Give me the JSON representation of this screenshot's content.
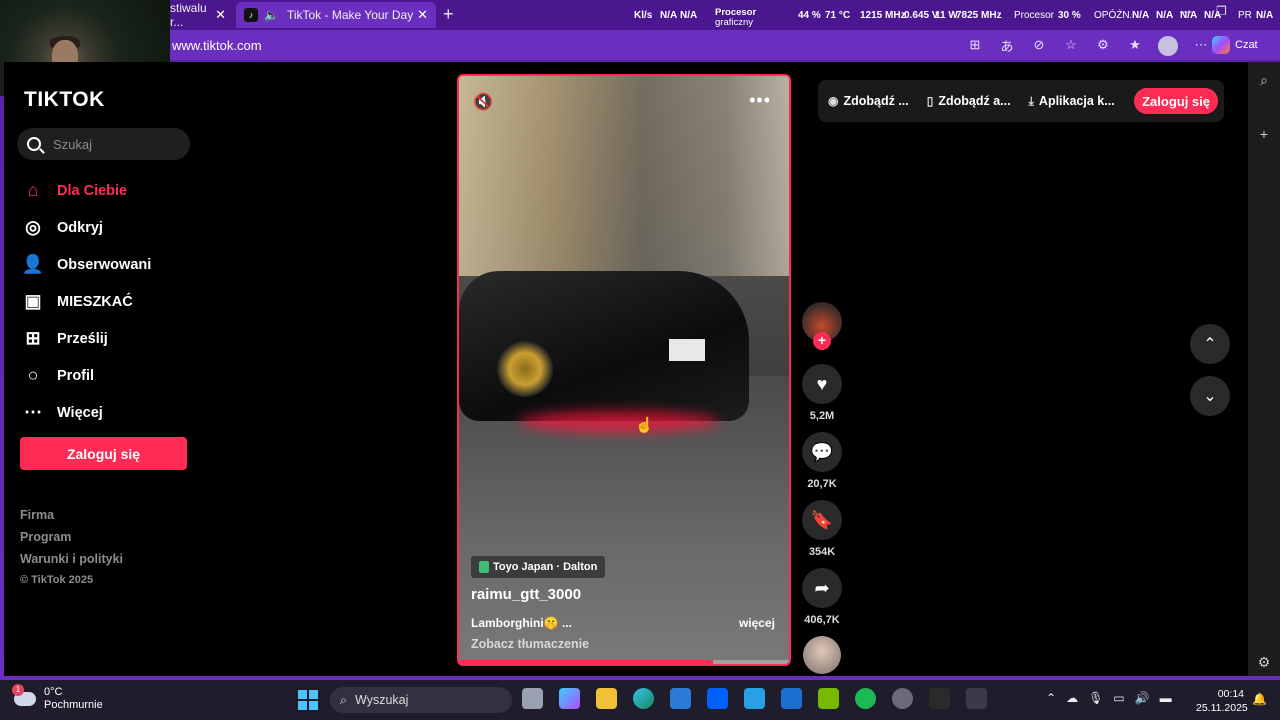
{
  "browser": {
    "tabs": [
      {
        "label": "stiwalu r..."
      },
      {
        "label": "TikTok - Make Your Day"
      }
    ],
    "url": "www.tiktok.com",
    "czat_label": "Czat",
    "hud": {
      "kls_label": "Kl/s",
      "kls_v1": "N/A",
      "kls_v2": "N/A",
      "gpu_label_1": "Procesor",
      "gpu_label_2": "graficzny",
      "gpu_load": "44 %",
      "gpu_temp": "71 °C",
      "gpu_clock": "1215 MHz",
      "gpu_volt": "0.645 V",
      "gpu_power": "11 W",
      "gpu_mem": "7825 MHz",
      "cpu_label": "Procesor",
      "cpu_load": "30 %",
      "lat_label": "OPÓŹN.",
      "lat_v1": "N/A",
      "lat_v2": "N/A",
      "lat_v3": "N/A",
      "lat_v4": "N/A",
      "pr_label": "PR",
      "pr_v": "N/A"
    }
  },
  "tiktok": {
    "brand": "TIKTOK",
    "search_placeholder": "Szukaj",
    "nav": [
      {
        "label": "Dla Ciebie",
        "icon": "home-icon",
        "glyph": "⌂",
        "active": true
      },
      {
        "label": "Odkryj",
        "icon": "compass-icon",
        "glyph": "◎",
        "active": false
      },
      {
        "label": "Obserwowani",
        "icon": "following-icon",
        "glyph": "👤",
        "active": false
      },
      {
        "label": "MIESZKAĆ",
        "icon": "live-icon",
        "glyph": "▣",
        "active": false
      },
      {
        "label": "Prześlij",
        "icon": "upload-icon",
        "glyph": "⊞",
        "active": false
      },
      {
        "label": "Profil",
        "icon": "profile-icon",
        "glyph": "○",
        "active": false
      },
      {
        "label": "Więcej",
        "icon": "more-icon",
        "glyph": "⋯",
        "active": false
      }
    ],
    "login_label": "Zaloguj się",
    "footer": {
      "firma": "Firma",
      "program": "Program",
      "terms": "Warunki i polityki",
      "copyright": "© TikTok 2025"
    },
    "top_pills": [
      {
        "icon": "coin-icon",
        "glyph": "◉",
        "label": "Zdobądź ..."
      },
      {
        "icon": "phone-icon",
        "glyph": "▯",
        "label": "Zdobądź a..."
      },
      {
        "icon": "download-icon",
        "glyph": "⤓",
        "label": "Aplikacja k..."
      }
    ],
    "top_login_label": "Zaloguj się",
    "video": {
      "tag": "Toyo Japan · Dalton",
      "username": "raimu_gtt_3000",
      "description": "Lamborghini🤫 ...",
      "more_label": "więcej",
      "translate_label": "Zobacz tłumaczenie",
      "progress": 0.76
    },
    "actions": {
      "likes": "5,2M",
      "comments": "20,7K",
      "saves": "354K",
      "shares": "406,7K"
    }
  },
  "taskbar": {
    "temperature": "0°C",
    "weather": "Pochmurnie",
    "weather_badge": "1",
    "search_label": "Wyszukaj",
    "time": "00:14",
    "date": "25.11.2025"
  }
}
